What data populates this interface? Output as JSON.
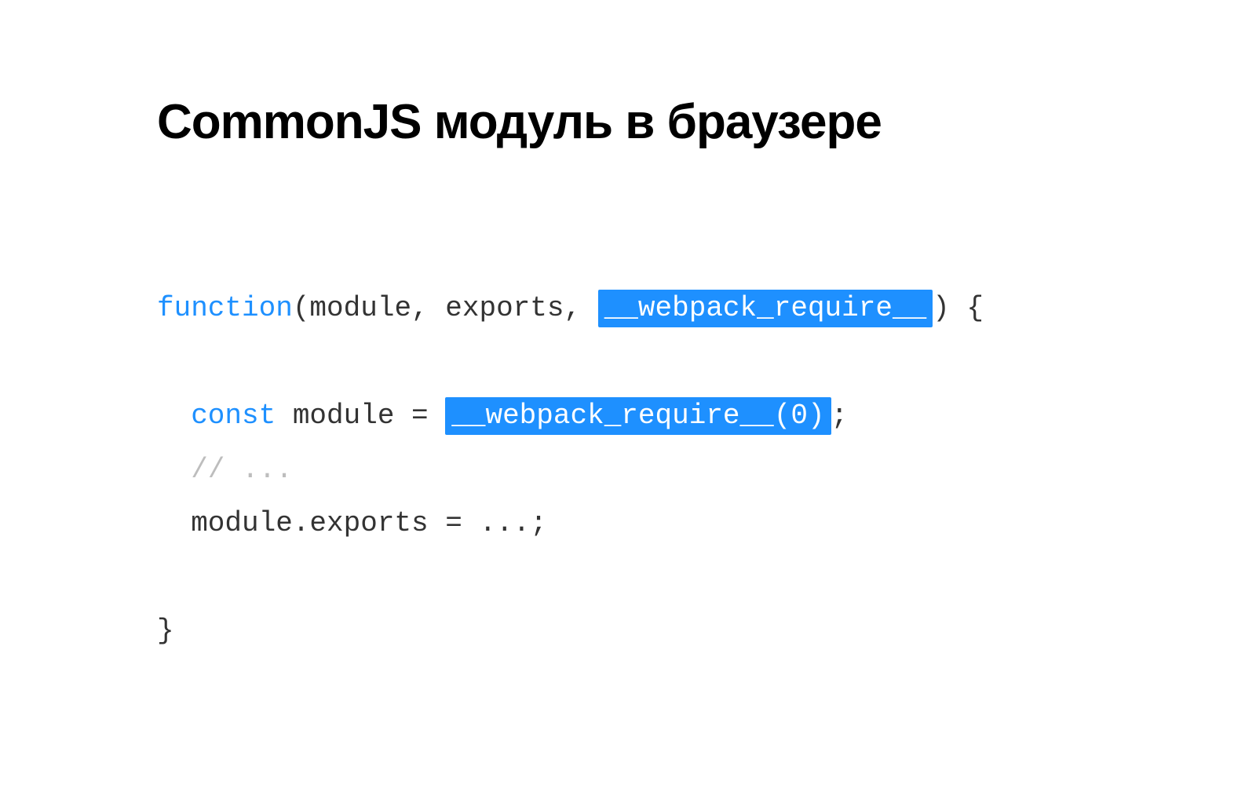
{
  "title": "CommonJS модуль в браузере",
  "code": {
    "l1": {
      "kw": "function",
      "plain1": "(module, exports, ",
      "hl": "__webpack_require__",
      "plain2": ") {"
    },
    "l2": {
      "kw": "const",
      "plain1": " module = ",
      "hl": "__webpack_require__(0)",
      "plain2": ";"
    },
    "l3": {
      "comment": "// ..."
    },
    "l4": {
      "plain": "module.exports = ...;"
    },
    "l5": {
      "plain": "}"
    }
  }
}
